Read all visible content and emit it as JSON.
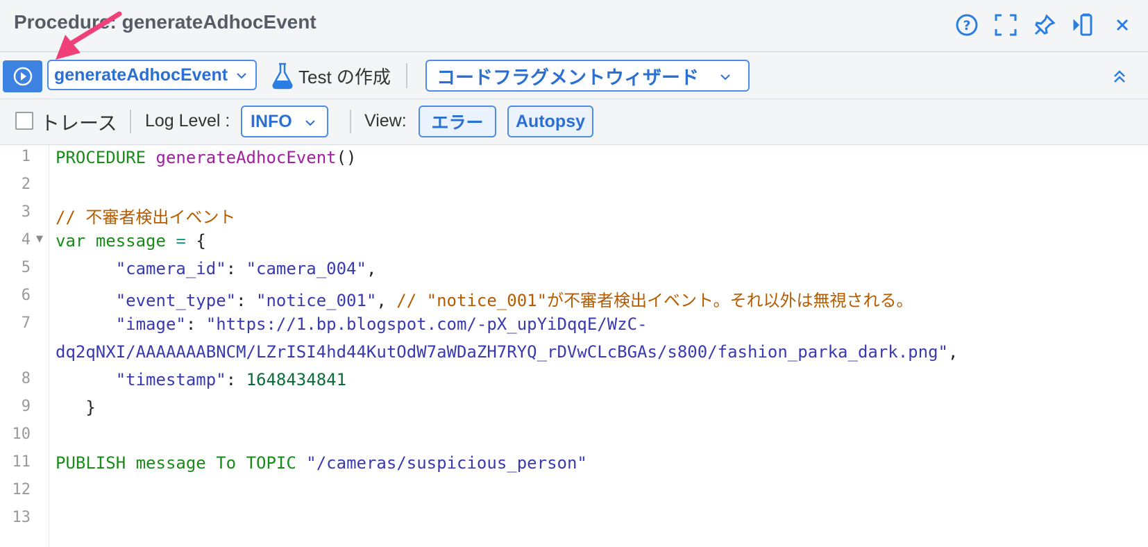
{
  "window": {
    "title": "Procedure: generateAdhocEvent"
  },
  "toolbar": {
    "procedure_select": "generateAdhocEvent",
    "test_label": "Test の作成",
    "wizard_label": "コードフラグメントウィザード"
  },
  "options": {
    "trace_label": "トレース",
    "log_level_label": "Log Level :",
    "log_level_value": "INFO",
    "view_label": "View:",
    "view_error": "エラー",
    "view_autopsy": "Autopsy"
  },
  "editor": {
    "line_numbers": [
      "1",
      "2",
      "3",
      "4",
      "5",
      "6",
      "7",
      "",
      "8",
      "9",
      "10",
      "11",
      "12",
      "13"
    ],
    "code": {
      "l1_kw": "PROCEDURE",
      "l1_fn": "generateAdhocEvent",
      "l1_paren": "()",
      "l3_comment": "// 不審者検出イベント",
      "l4_var": "var",
      "l4_name": "message",
      "l4_eq": "=",
      "l4_brace": "{",
      "l5_key": "\"camera_id\"",
      "l5_val": "\"camera_004\"",
      "l6_key": "\"event_type\"",
      "l6_val": "\"notice_001\"",
      "l6_comment": "// \"notice_001\"が不審者検出イベント。それ以外は無視される。",
      "l7_key": "\"image\"",
      "l7_val_a": "\"https://1.bp.blogspot.com/-pX_upYiDqqE/WzC-",
      "l7_val_b": "dq2qNXI/AAAAAAABNCM/LZrISI4hd44KutOdW7aWDaZH7RYQ_rDVwCLcBGAs/s800/fashion_parka_dark.png\"",
      "l8_key": "\"timestamp\"",
      "l8_val": "1648434841",
      "l9_brace": "}",
      "l11_kw1": "PUBLISH",
      "l11_name": "message",
      "l11_kw2": "To",
      "l11_kw3": "TOPIC",
      "l11_str": "\"/cameras/suspicious_person\""
    }
  },
  "colors": {
    "accent": "#3d82e0",
    "annotation_arrow": "#f0407a"
  },
  "icons": [
    "help-icon",
    "fullscreen-icon",
    "pin-icon",
    "dock-icon",
    "close-icon",
    "run-icon",
    "flask-icon",
    "chevron-down-icon",
    "collapse-up-icon"
  ]
}
